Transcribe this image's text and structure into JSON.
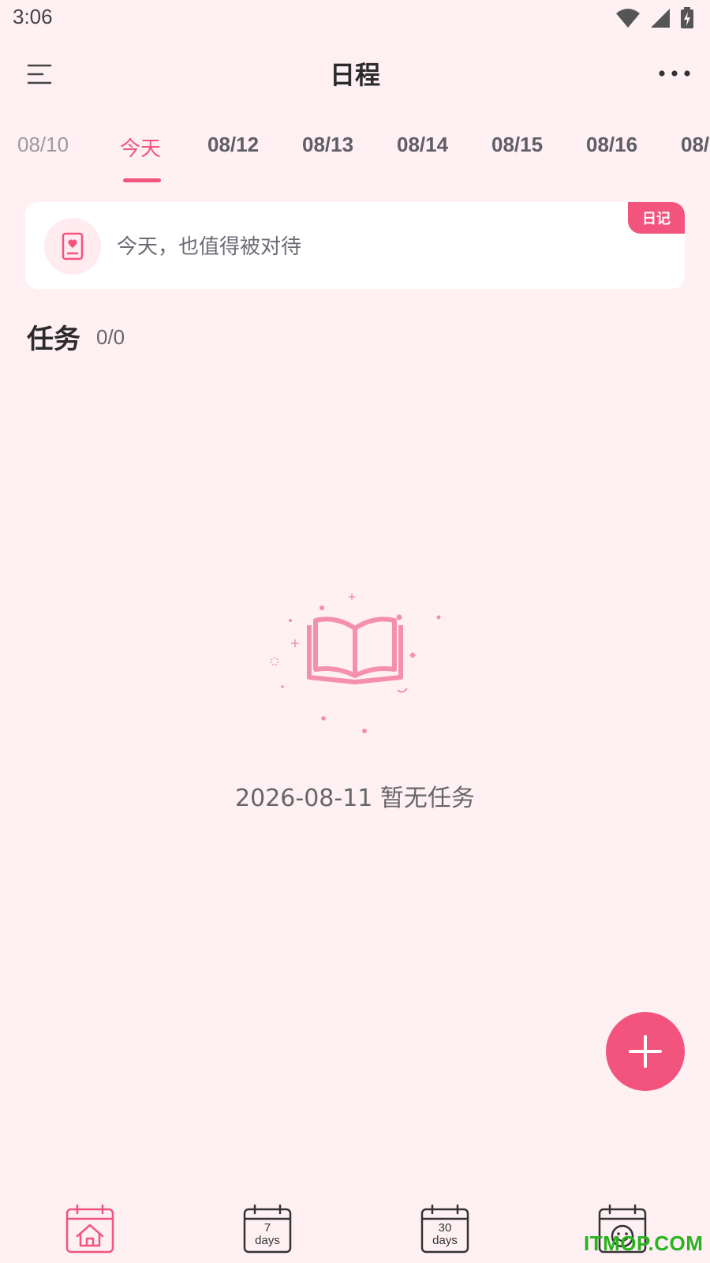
{
  "status_bar": {
    "time": "3:06",
    "icons": [
      "wifi-icon",
      "cellular-signal-icon",
      "battery-charging-icon"
    ]
  },
  "header": {
    "title": "日程",
    "menu_icon": "menu-icon",
    "more_icon": "more-dots-icon"
  },
  "date_tabs": [
    {
      "label": "08/10",
      "state": "past"
    },
    {
      "label": "今天",
      "state": "active"
    },
    {
      "label": "08/12",
      "state": "future"
    },
    {
      "label": "08/13",
      "state": "future"
    },
    {
      "label": "08/14",
      "state": "future"
    },
    {
      "label": "08/15",
      "state": "future"
    },
    {
      "label": "08/16",
      "state": "future"
    },
    {
      "label": "08/",
      "state": "future"
    }
  ],
  "diary_card": {
    "prompt": "今天，也值得被对待",
    "badge": "日记",
    "icon": "diary-heart-icon"
  },
  "tasks": {
    "title": "任务",
    "count": "0/0"
  },
  "empty_state": {
    "message": "2026-08-11 暂无任务",
    "illustration": "open-book-icon"
  },
  "fab": {
    "icon": "plus-icon"
  },
  "bottom_nav": [
    {
      "id": "home",
      "icon": "calendar-home-icon",
      "line1": "",
      "line2": ""
    },
    {
      "id": "seven-days",
      "icon": "calendar-7-days-icon",
      "line1": "7",
      "line2": "days"
    },
    {
      "id": "thirty-days",
      "icon": "calendar-30-days-icon",
      "line1": "30",
      "line2": "days"
    },
    {
      "id": "mood",
      "icon": "calendar-smiley-icon",
      "line1": "",
      "line2": ""
    }
  ],
  "watermark": "ITMOP.COM",
  "colors": {
    "background": "#FFF0F3",
    "accent": "#F2547D",
    "watermark": "#28B31F"
  }
}
